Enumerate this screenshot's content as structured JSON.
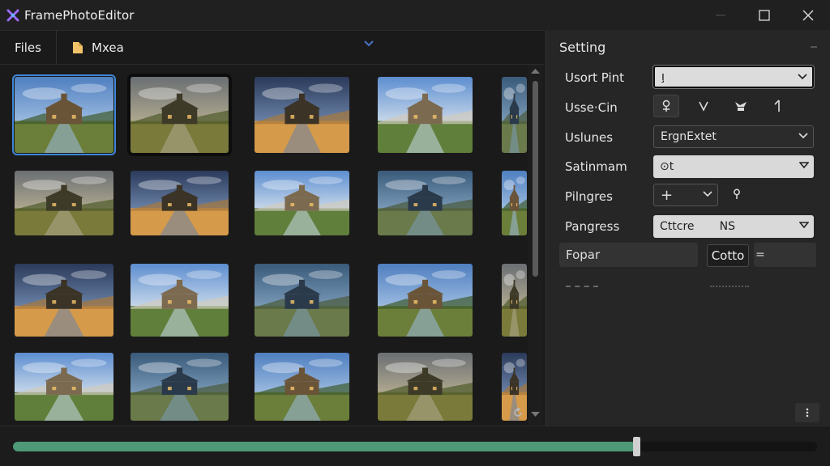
{
  "window": {
    "title": "FramePhotoEditor",
    "accent": "#3d86d8"
  },
  "files_panel": {
    "tab_files": "Files",
    "folder_name": "Mxea",
    "thumbnails": [
      {
        "scene": "village-river",
        "selected": true
      },
      {
        "scene": "valley",
        "selected": false
      },
      {
        "scene": "castle-dusk",
        "selected": false
      },
      {
        "scene": "manor",
        "selected": false
      },
      {
        "scene": "river-edge",
        "selected": false
      },
      {
        "scene": "manor-lawn",
        "selected": false
      },
      {
        "scene": "street",
        "selected": false
      },
      {
        "scene": "church-reflection",
        "selected": false
      },
      {
        "scene": "church-canal",
        "selected": false
      },
      {
        "scene": "tower-edge",
        "selected": false
      },
      {
        "scene": "castle-sunset",
        "selected": false
      },
      {
        "scene": "cathedral-path",
        "selected": false
      },
      {
        "scene": "mountain-road",
        "selected": false
      },
      {
        "scene": "church-lake",
        "selected": false
      },
      {
        "scene": "clouds-edge",
        "selected": false
      },
      {
        "scene": "church-field",
        "selected": false
      },
      {
        "scene": "castle-lake",
        "selected": false
      },
      {
        "scene": "mansion-night",
        "selected": false
      },
      {
        "scene": "cottages",
        "selected": false
      },
      {
        "scene": "sky-edge",
        "selected": false
      }
    ]
  },
  "settings": {
    "title": "Setting",
    "rows": [
      {
        "label": "Usort Pint",
        "value": "ı̧"
      },
      {
        "label": "Usse·Cin",
        "value": ""
      },
      {
        "label": "Uslunes",
        "value": "ErgnExtet"
      },
      {
        "label": "Satinmam",
        "value": "⊙t"
      },
      {
        "label": "Pilngres",
        "value": "+"
      },
      {
        "label": "Pangress",
        "value": "Cttcre       NS"
      }
    ],
    "fopar_label": "Fopar",
    "cotto_button": "Cotto",
    "equals": "="
  },
  "timeline": {
    "progress": 0.775,
    "fill_color": "#4e9a78"
  }
}
